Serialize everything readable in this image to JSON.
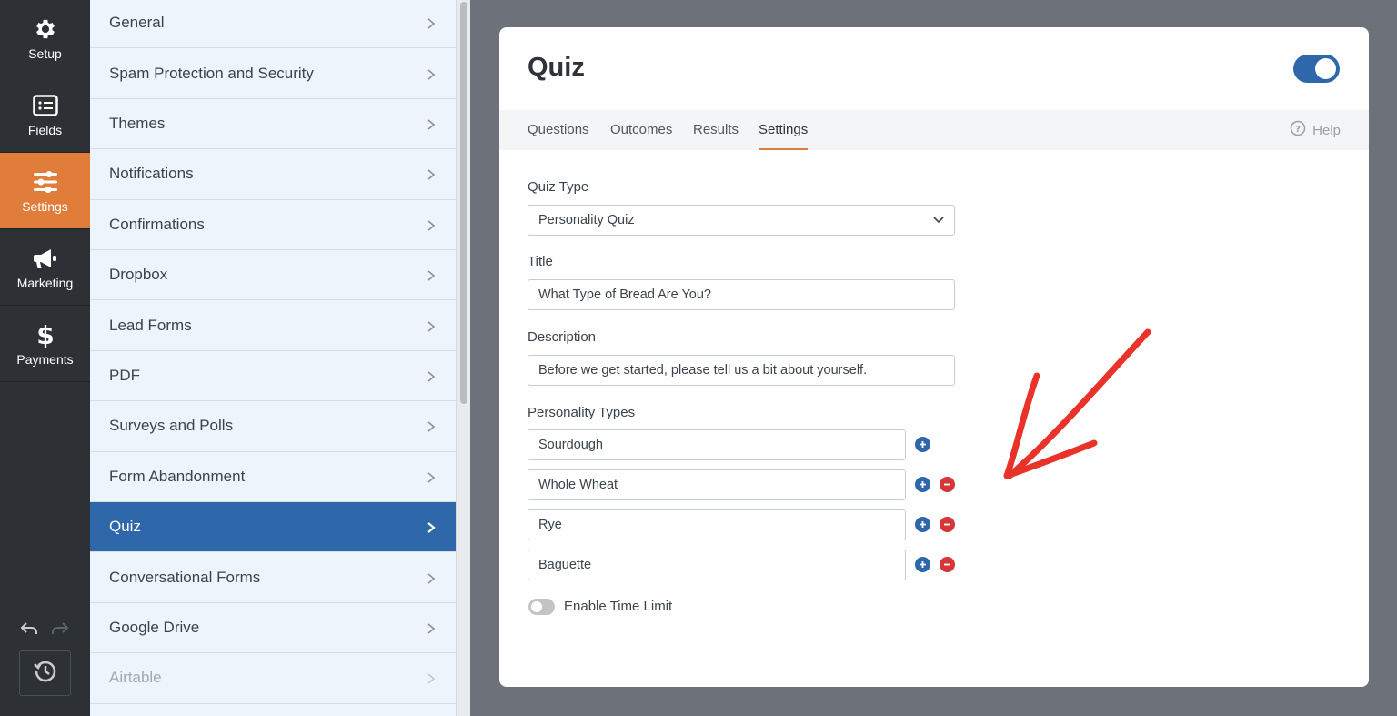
{
  "rail": {
    "items": [
      {
        "label": "Setup",
        "icon": "gear-icon"
      },
      {
        "label": "Fields",
        "icon": "fields-list-icon"
      },
      {
        "label": "Settings",
        "icon": "sliders-icon",
        "active": true
      },
      {
        "label": "Marketing",
        "icon": "megaphone-icon"
      },
      {
        "label": "Payments",
        "icon": "dollar-icon"
      }
    ],
    "icons": [
      "undo-icon",
      "redo-icon",
      "history-icon"
    ]
  },
  "settings_panel": {
    "items": [
      {
        "label": "General"
      },
      {
        "label": "Spam Protection and Security"
      },
      {
        "label": "Themes"
      },
      {
        "label": "Notifications"
      },
      {
        "label": "Confirmations"
      },
      {
        "label": "Dropbox"
      },
      {
        "label": "Lead Forms"
      },
      {
        "label": "PDF"
      },
      {
        "label": "Surveys and Polls"
      },
      {
        "label": "Form Abandonment"
      },
      {
        "label": "Quiz",
        "active": true
      },
      {
        "label": "Conversational Forms"
      },
      {
        "label": "Google Drive"
      },
      {
        "label": "Airtable",
        "disabled": true
      }
    ]
  },
  "card": {
    "title": "Quiz",
    "enabled": true,
    "tabs": [
      {
        "label": "Questions"
      },
      {
        "label": "Outcomes"
      },
      {
        "label": "Results"
      },
      {
        "label": "Settings",
        "active": true
      }
    ],
    "help_label": "Help",
    "quiz_type": {
      "label": "Quiz Type",
      "value": "Personality Quiz"
    },
    "title_field": {
      "label": "Title",
      "value": "What Type of Bread Are You?"
    },
    "description_field": {
      "label": "Description",
      "value": "Before we get started, please tell us a bit about yourself."
    },
    "personality_types": {
      "label": "Personality Types",
      "items": [
        "Sourdough",
        "Whole Wheat",
        "Rye",
        "Baguette"
      ]
    },
    "time_limit": {
      "label": "Enable Time Limit",
      "enabled": false
    }
  },
  "colors": {
    "accent": "#e07d3b",
    "primary": "#2f68aa",
    "danger": "#d63638",
    "annotation": "#e8322a"
  }
}
